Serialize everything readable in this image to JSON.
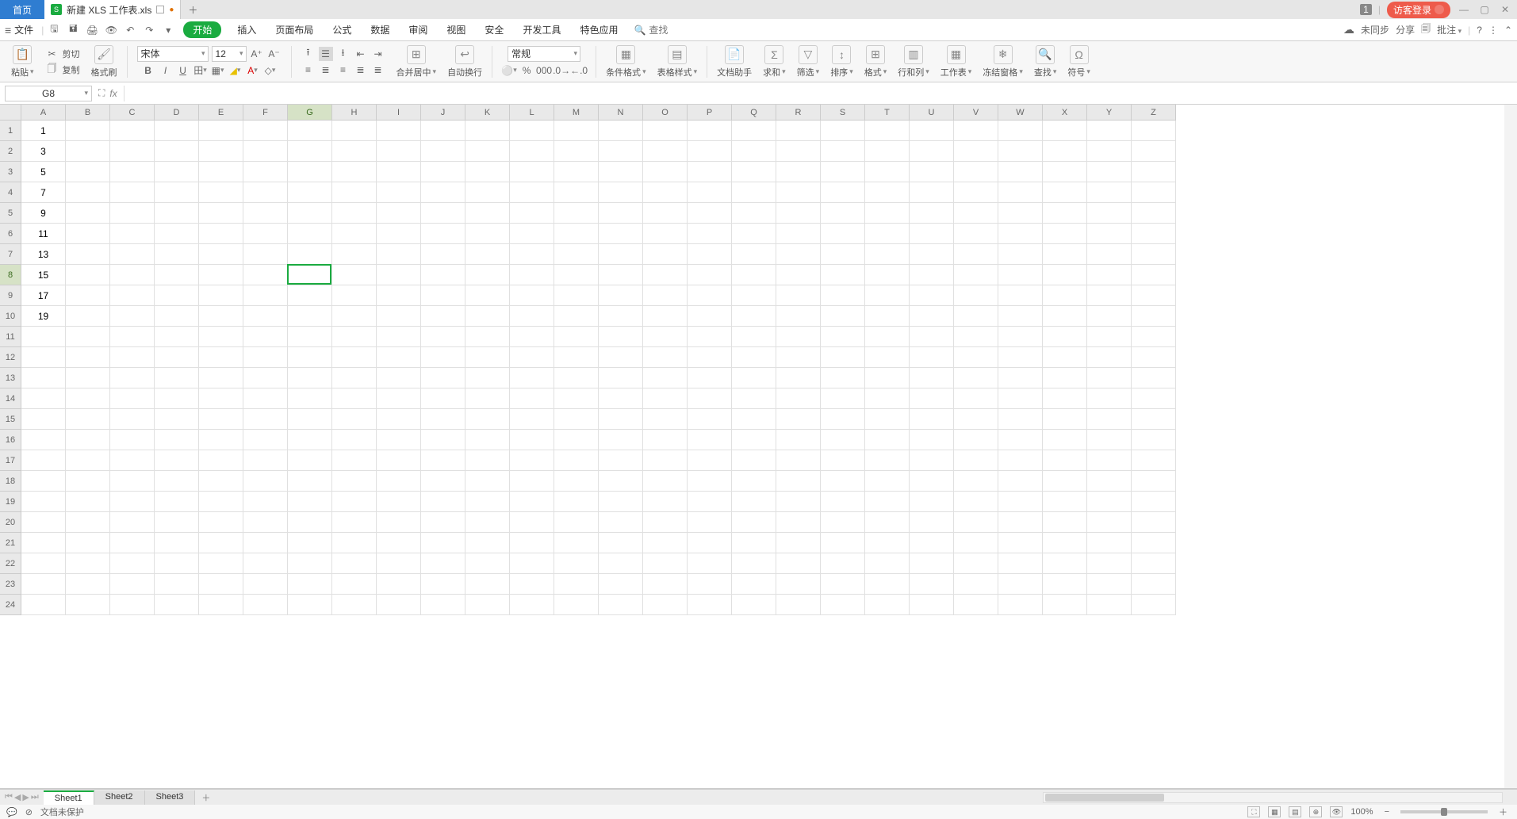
{
  "titlebar": {
    "home": "首页",
    "doc_name": "新建 XLS 工作表.xls",
    "limit_badge": "1",
    "login": "访客登录"
  },
  "menubar": {
    "file": "文件",
    "active": "开始",
    "items": [
      "插入",
      "页面布局",
      "公式",
      "数据",
      "审阅",
      "视图",
      "安全",
      "开发工具",
      "特色应用"
    ],
    "search_placeholder": "查找",
    "unsynced": "未同步",
    "share": "分享",
    "annotate": "批注"
  },
  "ribbon": {
    "paste": "粘贴",
    "cut": "剪切",
    "copy": "复制",
    "fmt_painter": "格式刷",
    "font_name": "宋体",
    "font_size": "12",
    "merge_center": "合并居中",
    "wrap_text": "自动换行",
    "num_format": "常规",
    "cond_fmt": "条件格式",
    "table_style": "表格样式",
    "doc_helper": "文档助手",
    "sum": "求和",
    "filter": "筛选",
    "sort": "排序",
    "format": "格式",
    "rowcol": "行和列",
    "worksheet": "工作表",
    "freeze": "冻结窗格",
    "find": "查找",
    "symbol": "符号"
  },
  "formula_bar": {
    "namebox": "G8",
    "value": ""
  },
  "grid": {
    "columns": [
      "A",
      "B",
      "C",
      "D",
      "E",
      "F",
      "G",
      "H",
      "I",
      "J",
      "K",
      "L",
      "M",
      "N",
      "O",
      "P",
      "Q",
      "R",
      "S",
      "T",
      "U",
      "V",
      "W",
      "X",
      "Y",
      "Z"
    ],
    "row_count": 24,
    "data_colA": [
      "1",
      "3",
      "5",
      "7",
      "9",
      "11",
      "13",
      "15",
      "17",
      "19"
    ],
    "selected_col_index": 6,
    "selected_row_index": 7
  },
  "sheets": {
    "tabs": [
      "Sheet1",
      "Sheet2",
      "Sheet3"
    ],
    "active_index": 0
  },
  "status": {
    "protect": "文档未保护",
    "zoom": "100%"
  }
}
